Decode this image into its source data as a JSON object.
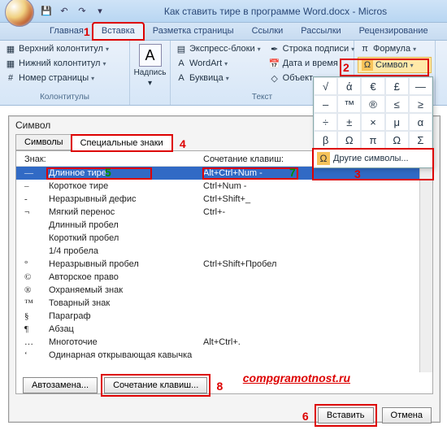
{
  "window_title": "Как ставить тире в программе Word.docx - Micros",
  "ribbon_tabs": [
    "Главная",
    "Вставка",
    "Разметка страницы",
    "Ссылки",
    "Рассылки",
    "Рецензирование"
  ],
  "active_tab_index": 1,
  "callouts": {
    "n1": "1",
    "n2": "2",
    "n3": "3",
    "n4": "4",
    "n5": "5",
    "n6": "6",
    "n7": "7",
    "n8": "8"
  },
  "ribbon": {
    "kolontituly": {
      "top": "Верхний колонтитул",
      "bottom": "Нижний колонтитул",
      "pagenum": "Номер страницы",
      "group": "Колонтитулы"
    },
    "nadpis": "Надпись",
    "text_group": "Текст",
    "express": "Экспресс-блоки",
    "wordart": "WordArt",
    "bukvica": "Буквица",
    "signature": "Строка подписи",
    "datetime": "Дата и время",
    "object": "Объект",
    "formula": "Формула",
    "symbol": "Символ"
  },
  "symbol_menu": {
    "cells": [
      "√",
      "ά",
      "€",
      "£",
      "—",
      "–",
      "™",
      "®",
      "≤",
      "≥",
      "÷",
      "±",
      "×",
      "μ",
      "α",
      "β",
      "Ω",
      "π",
      "Ω",
      "Σ"
    ],
    "more": "Другие символы..."
  },
  "dialog": {
    "title": "Символ",
    "tab_symbols": "Символы",
    "tab_special": "Специальные знаки",
    "col_char": "Знак:",
    "col_shortcut": "Сочетание клавиш:",
    "rows": [
      {
        "g": "—",
        "n": "Длинное тире",
        "k": "Alt+Ctrl+Num -"
      },
      {
        "g": "–",
        "n": "Короткое тире",
        "k": "Ctrl+Num -"
      },
      {
        "g": "-",
        "n": "Неразрывный дефис",
        "k": "Ctrl+Shift+_"
      },
      {
        "g": "¬",
        "n": "Мягкий перенос",
        "k": "Ctrl+-"
      },
      {
        "g": "",
        "n": "Длинный пробел",
        "k": ""
      },
      {
        "g": "",
        "n": "Короткий пробел",
        "k": ""
      },
      {
        "g": "",
        "n": "1/4 пробела",
        "k": ""
      },
      {
        "g": "°",
        "n": "Неразрывный пробел",
        "k": "Ctrl+Shift+Пробел"
      },
      {
        "g": "©",
        "n": "Авторское право",
        "k": ""
      },
      {
        "g": "®",
        "n": "Охраняемый знак",
        "k": ""
      },
      {
        "g": "™",
        "n": "Товарный знак",
        "k": ""
      },
      {
        "g": "§",
        "n": "Параграф",
        "k": ""
      },
      {
        "g": "¶",
        "n": "Абзац",
        "k": ""
      },
      {
        "g": "…",
        "n": "Многоточие",
        "k": "Alt+Ctrl+."
      },
      {
        "g": "‘",
        "n": "Одинарная открывающая кавычка",
        "k": ""
      }
    ],
    "btn_autochange": "Автозамена...",
    "btn_shortcut": "Сочетание клавиш...",
    "btn_insert": "Вставить",
    "btn_cancel": "Отмена"
  },
  "watermark": "compgramotnost.ru"
}
